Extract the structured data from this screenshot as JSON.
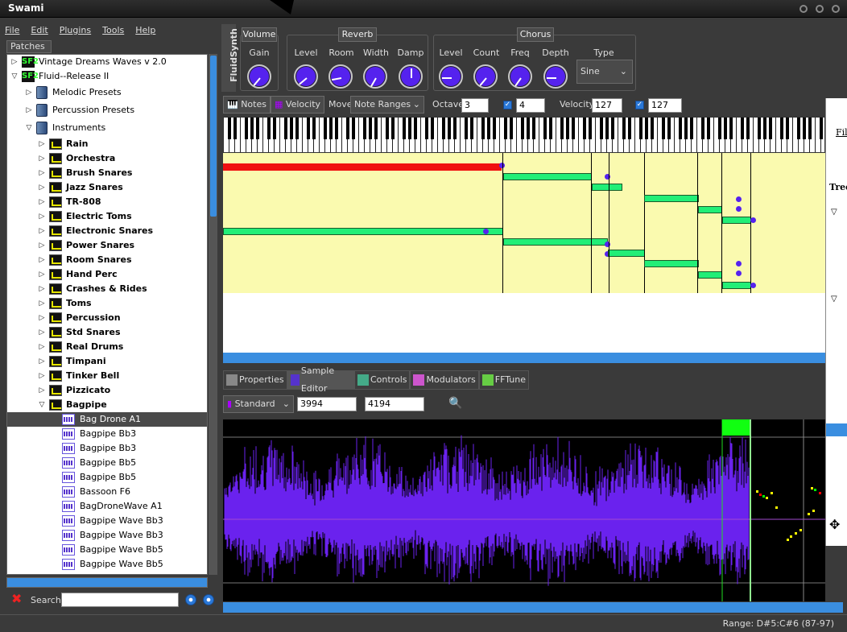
{
  "window": {
    "title": "Swami"
  },
  "menu": {
    "file": "File",
    "edit": "Edit",
    "plugins": "Plugins",
    "tools": "Tools",
    "help": "Help"
  },
  "patches_tab": "Patches",
  "tree": {
    "root1": "Vintage Dreams Waves v 2.0",
    "root2": "Fluid--Release II",
    "melodic": "Melodic Presets",
    "percussion": "Percussion Presets",
    "instruments": "Instruments",
    "items": [
      "Rain",
      "Orchestra",
      "Brush Snares",
      "Jazz Snares",
      "TR-808",
      "Electric Toms",
      "Electronic Snares",
      "Power Snares",
      "Room Snares",
      "Hand Perc",
      "Crashes & Rides",
      "Toms",
      "Percussion",
      "Std Snares",
      "Real Drums",
      "Timpani",
      "Tinker Bell",
      "Pizzicato",
      "Bagpipe"
    ],
    "samples": [
      "Bag Drone A1",
      "Bagpipe Bb3",
      "Bagpipe Bb3",
      "Bagpipe Bb5",
      "Bagpipe Bb5",
      "Bassoon F6",
      "BagDroneWave A1",
      "Bagpipe Wave Bb3",
      "Bagpipe Wave Bb3",
      "Bagpipe Wave Bb5",
      "Bagpipe Wave Bb5"
    ]
  },
  "search": {
    "label": "Search",
    "value": ""
  },
  "fluidsynth": {
    "side_label": "FluidSynth",
    "volume": {
      "title": "Volume",
      "gain": "Gain"
    },
    "reverb": {
      "title": "Reverb",
      "level": "Level",
      "room": "Room",
      "width": "Width",
      "damp": "Damp"
    },
    "chorus": {
      "title": "Chorus",
      "level": "Level",
      "count": "Count",
      "freq": "Freq",
      "depth": "Depth",
      "type": "Type",
      "type_value": "Sine"
    }
  },
  "toolbar": {
    "notes": "Notes",
    "velocity_btn": "Velocity",
    "move_label": "Move",
    "move_value": "Note Ranges",
    "octave_label": "Octave",
    "octave_value": "3",
    "oct2_value": "4",
    "velocity_label": "Velocity",
    "vel1_value": "127",
    "vel2_value": "127"
  },
  "tabs": {
    "properties": "Properties",
    "sample_editor": "Sample Editor",
    "controls": "Controls",
    "modulators": "Modulators",
    "fftune": "FFTune"
  },
  "sample_editor": {
    "mode": "Standard",
    "start": "3994",
    "end": "4194"
  },
  "status": {
    "range": "Range: D#5:C#6 (87-97)"
  },
  "overlay_window": {
    "menu": "Fil",
    "label": "Tree"
  }
}
